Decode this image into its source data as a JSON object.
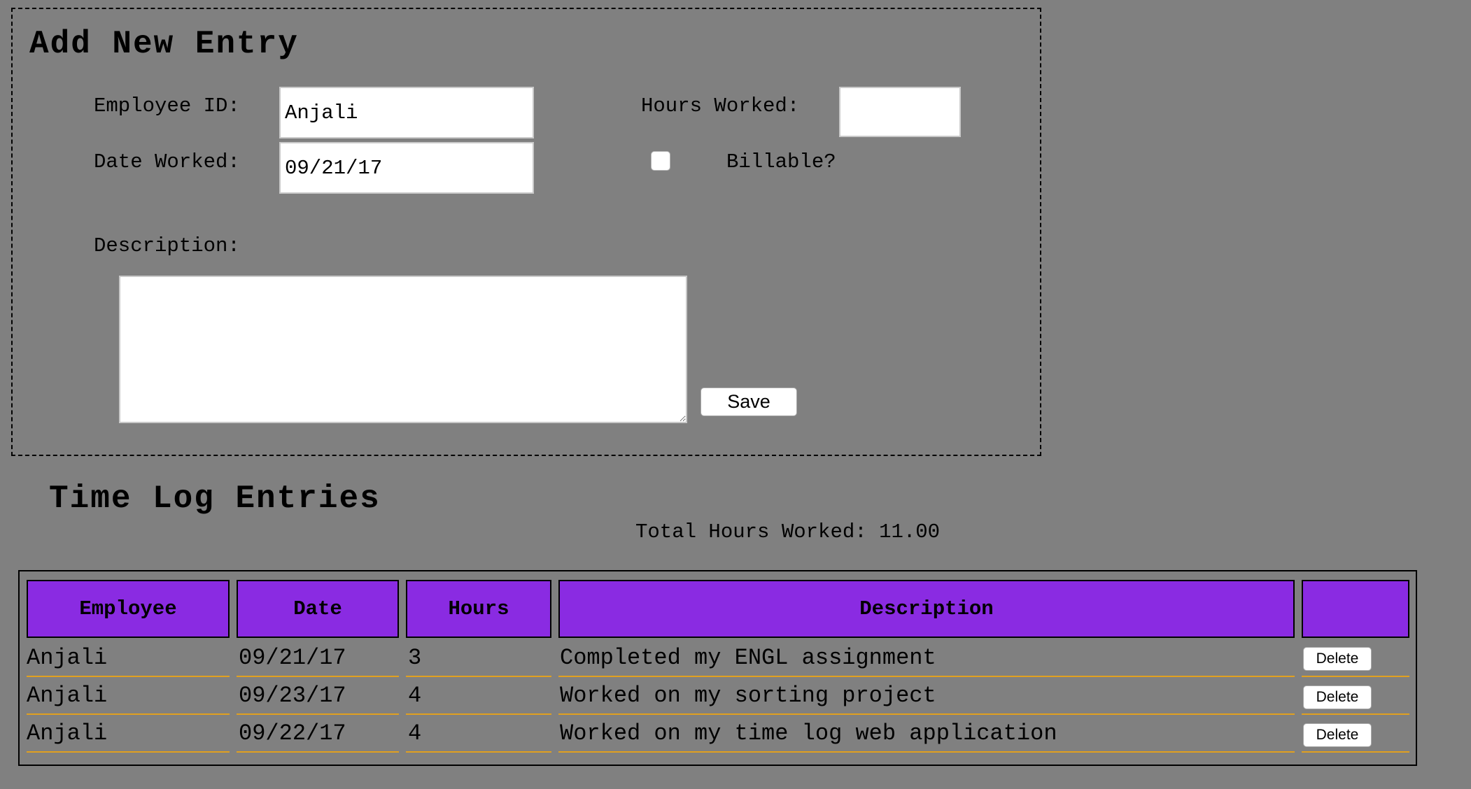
{
  "form": {
    "title": "Add New Entry",
    "employee_id_label": "Employee ID:",
    "employee_id_value": "Anjali",
    "hours_label": "Hours Worked:",
    "hours_value": "",
    "date_label": "Date Worked:",
    "date_value": "09/21/17",
    "billable_label": "Billable?",
    "billable_checked": false,
    "description_label": "Description:",
    "description_value": "",
    "save_label": "Save"
  },
  "log": {
    "title": "Time Log Entries",
    "total_label": "Total Hours Worked:",
    "total_value": "11.00",
    "columns": [
      "Employee",
      "Date",
      "Hours",
      "Description",
      ""
    ],
    "rows": [
      {
        "employee": "Anjali",
        "date": "09/21/17",
        "hours": "3",
        "description": "Completed my ENGL assignment",
        "delete_label": "Delete"
      },
      {
        "employee": "Anjali",
        "date": "09/23/17",
        "hours": "4",
        "description": "Worked on my sorting project",
        "delete_label": "Delete"
      },
      {
        "employee": "Anjali",
        "date": "09/22/17",
        "hours": "4",
        "description": "Worked on my time log web application",
        "delete_label": "Delete"
      }
    ]
  },
  "colors": {
    "page_background": "#808080",
    "header_background": "#8a2be2",
    "row_underline": "#e0a020"
  }
}
